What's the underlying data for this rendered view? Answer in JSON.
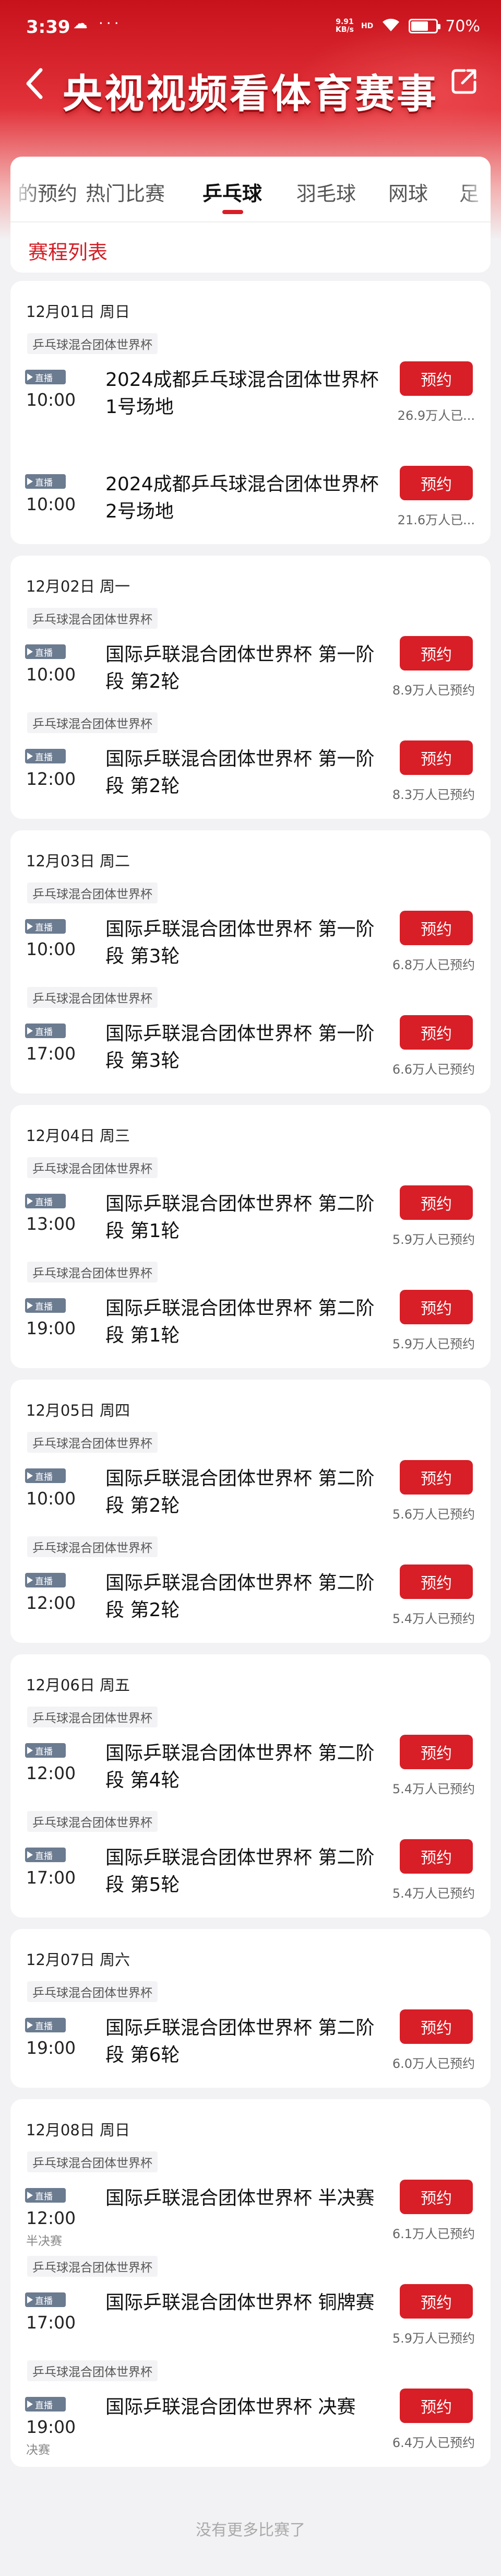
{
  "status_bar": {
    "time": "3:39",
    "dots": "☁ ···",
    "net_speed_top": "9.91",
    "net_speed_bottom": "KB/s",
    "signal": "HD",
    "battery_text": "70%",
    "battery_level": 0.7
  },
  "header": {
    "title": "央视视频看体育赛事"
  },
  "tabs": [
    {
      "label": "的预约",
      "active": false
    },
    {
      "label": "热门比赛",
      "active": false
    },
    {
      "label": "乒乓球",
      "active": true
    },
    {
      "label": "羽毛球",
      "active": false
    },
    {
      "label": "网球",
      "active": false
    },
    {
      "label": "足",
      "active": false
    }
  ],
  "section": {
    "title": "赛程列表"
  },
  "days": [
    {
      "date": "12月01日 周日",
      "matches": [
        {
          "league": "乒乓球混合团体世界杯",
          "badge": "直播",
          "time": "10:00",
          "note": "",
          "title": "2024成都乒乓球混合团体世界杯1号场地",
          "button": "预约",
          "count": "26.9万人已..."
        },
        {
          "league": "",
          "badge": "直播",
          "time": "10:00",
          "note": "",
          "title": "2024成都乒乓球混合团体世界杯2号场地",
          "button": "预约",
          "count": "21.6万人已..."
        }
      ]
    },
    {
      "date": "12月02日 周一",
      "matches": [
        {
          "league": "乒乓球混合团体世界杯",
          "badge": "直播",
          "time": "10:00",
          "note": "",
          "title": "国际乒联混合团体世界杯 第一阶段 第2轮",
          "button": "预约",
          "count": "8.9万人已预约"
        },
        {
          "league": "乒乓球混合团体世界杯",
          "badge": "直播",
          "time": "12:00",
          "note": "",
          "title": "国际乒联混合团体世界杯 第一阶段 第2轮",
          "button": "预约",
          "count": "8.3万人已预约"
        }
      ]
    },
    {
      "date": "12月03日 周二",
      "matches": [
        {
          "league": "乒乓球混合团体世界杯",
          "badge": "直播",
          "time": "10:00",
          "note": "",
          "title": "国际乒联混合团体世界杯 第一阶段 第3轮",
          "button": "预约",
          "count": "6.8万人已预约"
        },
        {
          "league": "乒乓球混合团体世界杯",
          "badge": "直播",
          "time": "17:00",
          "note": "",
          "title": "国际乒联混合团体世界杯 第一阶段 第3轮",
          "button": "预约",
          "count": "6.6万人已预约"
        }
      ]
    },
    {
      "date": "12月04日 周三",
      "matches": [
        {
          "league": "乒乓球混合团体世界杯",
          "badge": "直播",
          "time": "13:00",
          "note": "",
          "title": "国际乒联混合团体世界杯 第二阶段 第1轮",
          "button": "预约",
          "count": "5.9万人已预约"
        },
        {
          "league": "乒乓球混合团体世界杯",
          "badge": "直播",
          "time": "19:00",
          "note": "",
          "title": "国际乒联混合团体世界杯 第二阶段 第1轮",
          "button": "预约",
          "count": "5.9万人已预约"
        }
      ]
    },
    {
      "date": "12月05日 周四",
      "matches": [
        {
          "league": "乒乓球混合团体世界杯",
          "badge": "直播",
          "time": "10:00",
          "note": "",
          "title": "国际乒联混合团体世界杯 第二阶段 第2轮",
          "button": "预约",
          "count": "5.6万人已预约"
        },
        {
          "league": "乒乓球混合团体世界杯",
          "badge": "直播",
          "time": "12:00",
          "note": "",
          "title": "国际乒联混合团体世界杯 第二阶段 第2轮",
          "button": "预约",
          "count": "5.4万人已预约"
        }
      ]
    },
    {
      "date": "12月06日 周五",
      "matches": [
        {
          "league": "乒乓球混合团体世界杯",
          "badge": "直播",
          "time": "12:00",
          "note": "",
          "title": "国际乒联混合团体世界杯 第二阶段 第4轮",
          "button": "预约",
          "count": "5.4万人已预约"
        },
        {
          "league": "乒乓球混合团体世界杯",
          "badge": "直播",
          "time": "17:00",
          "note": "",
          "title": "国际乒联混合团体世界杯 第二阶段 第5轮",
          "button": "预约",
          "count": "5.4万人已预约"
        }
      ]
    },
    {
      "date": "12月07日 周六",
      "matches": [
        {
          "league": "乒乓球混合团体世界杯",
          "badge": "直播",
          "time": "19:00",
          "note": "",
          "title": "国际乒联混合团体世界杯 第二阶段 第6轮",
          "button": "预约",
          "count": "6.0万人已预约"
        }
      ]
    },
    {
      "date": "12月08日 周日",
      "matches": [
        {
          "league": "乒乓球混合团体世界杯",
          "badge": "直播",
          "time": "12:00",
          "note": "半决赛",
          "title": "国际乒联混合团体世界杯 半决赛",
          "button": "预约",
          "count": "6.1万人已预约"
        },
        {
          "league": "乒乓球混合团体世界杯",
          "badge": "直播",
          "time": "17:00",
          "note": "",
          "title": "国际乒联混合团体世界杯 铜牌赛",
          "button": "预约",
          "count": "5.9万人已预约"
        },
        {
          "league": "乒乓球混合团体世界杯",
          "badge": "直播",
          "time": "19:00",
          "note": "决赛",
          "title": "国际乒联混合团体世界杯 决赛",
          "button": "预约",
          "count": "6.4万人已预约"
        }
      ]
    }
  ],
  "footer": {
    "text": "没有更多比赛了"
  },
  "colors": {
    "brand_red": "#d81e26",
    "header_red": "#c8121b",
    "badge_gray": "#6b7b90"
  },
  "icons": {
    "back": "chevron-left-icon",
    "share": "share-icon",
    "live_badge": "play-icon",
    "wifi": "wifi-icon",
    "battery": "battery-icon"
  }
}
